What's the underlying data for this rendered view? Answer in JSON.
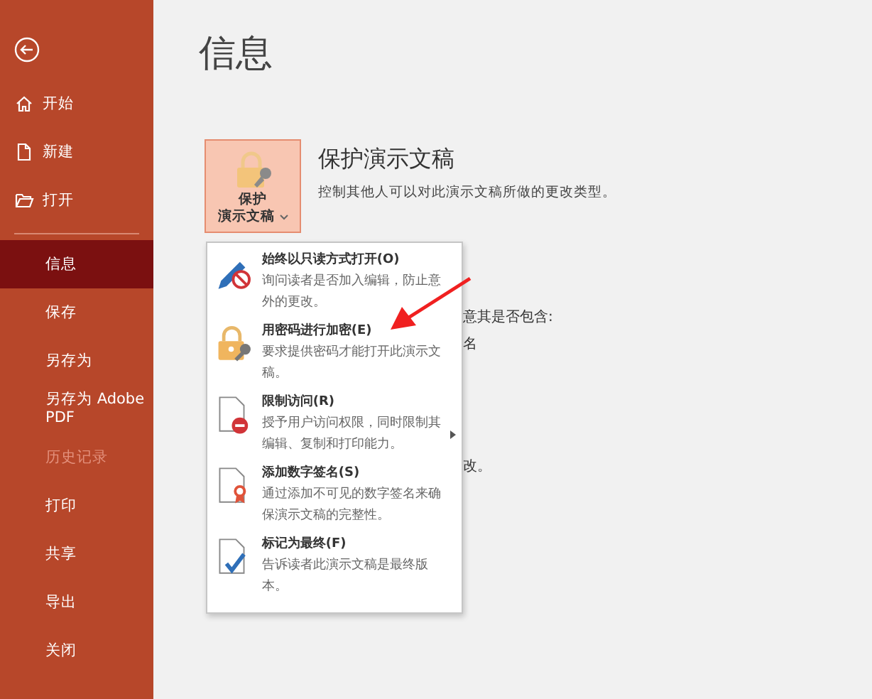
{
  "sidebar": {
    "items": [
      {
        "label": "开始",
        "kind": "home",
        "selected": false,
        "disabled": false
      },
      {
        "label": "新建",
        "kind": "new",
        "selected": false,
        "disabled": false
      },
      {
        "label": "打开",
        "kind": "open",
        "selected": false,
        "disabled": false
      },
      {
        "label": "信息",
        "kind": "plain",
        "selected": true,
        "disabled": false
      },
      {
        "label": "保存",
        "kind": "plain",
        "selected": false,
        "disabled": false
      },
      {
        "label": "另存为",
        "kind": "plain",
        "selected": false,
        "disabled": false
      },
      {
        "label": "另存为 Adobe PDF",
        "kind": "plain",
        "selected": false,
        "disabled": false
      },
      {
        "label": "历史记录",
        "kind": "plain",
        "selected": false,
        "disabled": true
      },
      {
        "label": "打印",
        "kind": "plain",
        "selected": false,
        "disabled": false
      },
      {
        "label": "共享",
        "kind": "plain",
        "selected": false,
        "disabled": false
      },
      {
        "label": "导出",
        "kind": "plain",
        "selected": false,
        "disabled": false
      },
      {
        "label": "关闭",
        "kind": "plain",
        "selected": false,
        "disabled": false
      }
    ]
  },
  "page_title": "信息",
  "protect": {
    "button_lines": [
      "保护",
      "演示文稿"
    ],
    "heading": "保护演示文稿",
    "description": "控制其他人可以对此演示文稿所做的更改类型。"
  },
  "background_fragments": [
    "意其是否包含:",
    "名",
    "改。"
  ],
  "menu": {
    "items": [
      {
        "kind": "read-only",
        "title": "始终以只读方式打开(O)",
        "description": "询问读者是否加入编辑，防止意外的更改。",
        "submenu": false
      },
      {
        "kind": "password",
        "title": "用密码进行加密(E)",
        "description": "要求提供密码才能打开此演示文稿。",
        "submenu": false
      },
      {
        "kind": "restrict",
        "title": "限制访问(R)",
        "description": "授予用户访问权限，同时限制其编辑、复制和打印能力。",
        "submenu": true
      },
      {
        "kind": "signature",
        "title": "添加数字签名(S)",
        "description": "通过添加不可见的数字签名来确保演示文稿的完整性。",
        "submenu": false
      },
      {
        "kind": "final",
        "title": "标记为最终(F)",
        "description": "告诉读者此演示文稿是最终版本。",
        "submenu": false
      }
    ]
  }
}
